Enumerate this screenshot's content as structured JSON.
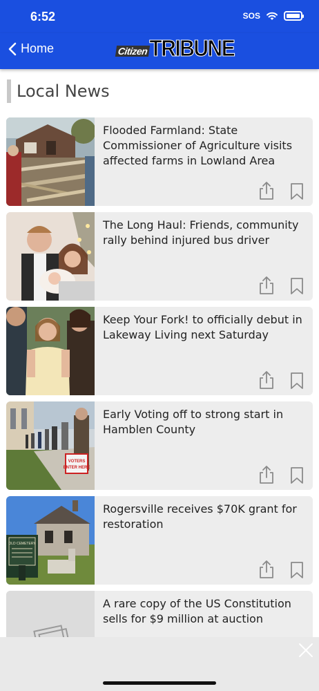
{
  "status_bar": {
    "time": "6:52",
    "sos": "SOS"
  },
  "nav": {
    "back_label": "Home",
    "logo_small": "Citizen",
    "logo_big": "TRIBUNE"
  },
  "section": {
    "title": "Local News"
  },
  "articles": [
    {
      "title": "Flooded Farmland: State Commissioner of Agriculture visits affected farms in Lowland Area"
    },
    {
      "title": "The Long Haul: Friends, community rally behind injured bus driver"
    },
    {
      "title": "Keep Your Fork! to  officially debut in Lakeway Living next Saturday"
    },
    {
      "title": "Early Voting off to strong start in Hamblen County"
    },
    {
      "title": "Rogersville receives $70K grant for restoration"
    },
    {
      "title": "A rare copy of the US Constitution sells for $9 million at auction"
    }
  ],
  "thumb_text": {
    "sign_text": "VOTERS\nENTER HERE",
    "marker_text": "OLD CEMETERY"
  },
  "colors": {
    "brand": "#1a4fe0",
    "card_bg": "#ededed",
    "icon_gray": "#8a8a8a"
  }
}
